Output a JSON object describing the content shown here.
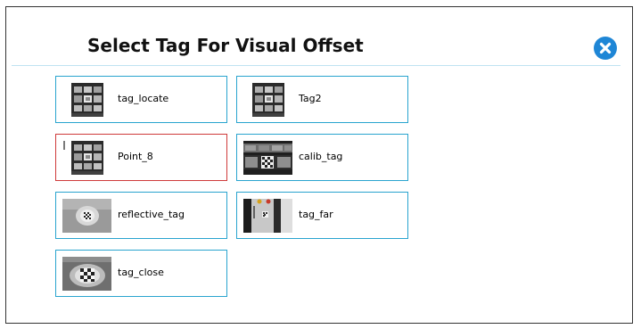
{
  "dialog": {
    "title": "Select Tag For Visual Offset",
    "close_icon": "close-icon",
    "accent_color": "#1e86d6",
    "tile_border_color": "#29a4cf",
    "selected_border_color": "#cf3a3a"
  },
  "tags": [
    {
      "label": "tag_locate",
      "selected": false
    },
    {
      "label": "Tag2",
      "selected": false
    },
    {
      "label": "Point_8",
      "selected": true
    },
    {
      "label": "calib_tag",
      "selected": false
    },
    {
      "label": "reflective_tag",
      "selected": false
    },
    {
      "label": "tag_far",
      "selected": false
    },
    {
      "label": "tag_close",
      "selected": false
    }
  ]
}
